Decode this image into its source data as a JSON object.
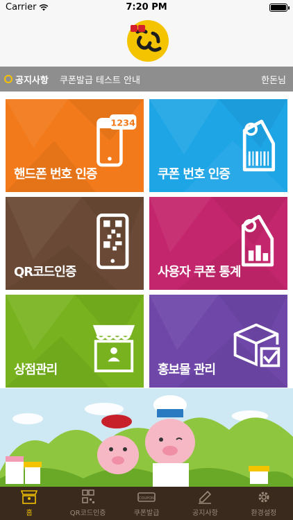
{
  "status_bar": {
    "carrier": "Carrier",
    "time": "7:20 PM"
  },
  "header": {
    "logo_icon": "handon-logo-icon"
  },
  "notice": {
    "title": "공지사항",
    "text": "쿠폰발급 테스트 안내",
    "user": "한돈님"
  },
  "tiles": [
    {
      "label": "핸드폰 번호 인증",
      "icon": "phone-1234-icon",
      "color": "#f27a1a"
    },
    {
      "label": "쿠폰 번호 인증",
      "icon": "barcode-tag-icon",
      "color": "#1ea5e6"
    },
    {
      "label": "QR코드인증",
      "icon": "qr-phone-icon",
      "color": "#6a4a36"
    },
    {
      "label": "사용자 쿠폰 통계",
      "icon": "stats-tag-icon",
      "color": "#c4266d"
    },
    {
      "label": "상점관리",
      "icon": "store-icon",
      "color": "#78b31f"
    },
    {
      "label": "홍보물 관리",
      "icon": "box-check-icon",
      "color": "#6e47a8"
    }
  ],
  "phone_digits": "1234",
  "tabbar": [
    {
      "label": "홈",
      "icon": "store-icon",
      "active": true
    },
    {
      "label": "QR코드인증",
      "icon": "qr-icon",
      "active": false
    },
    {
      "label": "쿠폰발급",
      "icon": "coupon-icon",
      "active": false
    },
    {
      "label": "공지사항",
      "icon": "pencil-icon",
      "active": false
    },
    {
      "label": "환경설정",
      "icon": "gear-icon",
      "active": false
    }
  ],
  "coupon_tab_text": "COUPON"
}
